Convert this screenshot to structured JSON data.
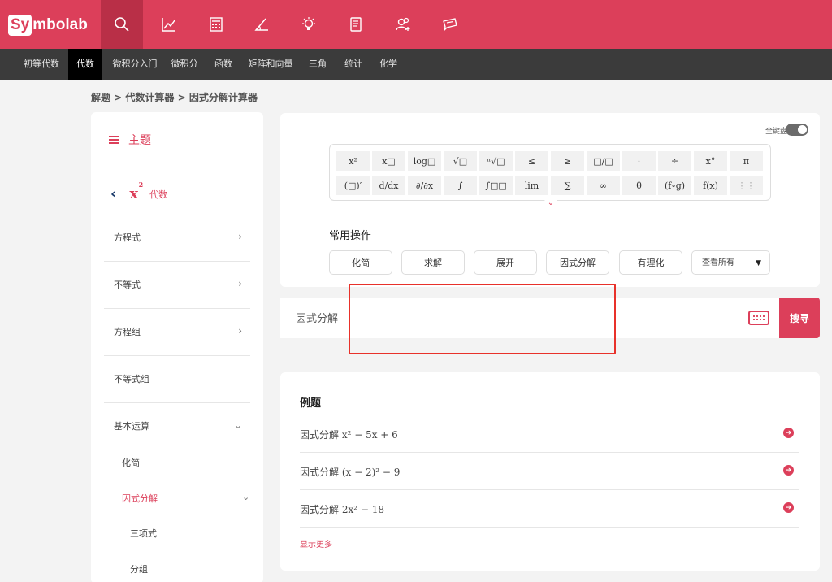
{
  "brand": {
    "logo_badge": "Sy",
    "logo_rest": "mbolab"
  },
  "topnav": {
    "icons": [
      "search-icon",
      "graph-icon",
      "calculator-icon",
      "geometry-icon",
      "lightbulb-icon",
      "notebook-icon",
      "users-icon",
      "chat-icon"
    ]
  },
  "subnav": {
    "items": [
      "初等代数",
      "代数",
      "微积分入门",
      "微积分",
      "函数",
      "矩阵和向量",
      "三角",
      "统计",
      "化学"
    ],
    "active": "代数"
  },
  "breadcrumb": "解题 > 代数计算器 > 因式分解计算器",
  "sidebar": {
    "heading": "主题",
    "back_label": "代数",
    "x2_icon": "x",
    "items": [
      "方程式",
      "不等式",
      "方程组",
      "不等式组",
      "基本运算"
    ],
    "subitems": [
      "化简",
      "因式分解",
      "三项式",
      "分组"
    ],
    "active_sub": "因式分解"
  },
  "keyboard": {
    "full_keyboard_label": "全键盘",
    "row1": [
      "x²",
      "x□",
      "log□",
      "√□",
      "ⁿ√□",
      "≤",
      "≥",
      "□/□",
      "·",
      "÷",
      "x°",
      "π"
    ],
    "row2": [
      "(□)′",
      "d/dx",
      "∂/∂x",
      "∫",
      "∫□□",
      "lim",
      "∑",
      "∞",
      "θ",
      "(f∘g)",
      "f(x)",
      "⋮⋮"
    ]
  },
  "common_ops": {
    "title": "常用操作",
    "buttons": [
      "化简",
      "求解",
      "展开",
      "因式分解",
      "有理化"
    ],
    "select_value": "查看所有"
  },
  "input": {
    "value": "因式分解",
    "search_label": "搜寻"
  },
  "examples": {
    "title": "例题",
    "items": [
      "因式分解 x² − 5x + 6",
      "因式分解 (x − 2)² − 9",
      "因式分解 2x² − 18"
    ],
    "show_more": "显示更多"
  },
  "colors": {
    "brand": "#dc3f5a",
    "highlight": "#e8312a"
  }
}
